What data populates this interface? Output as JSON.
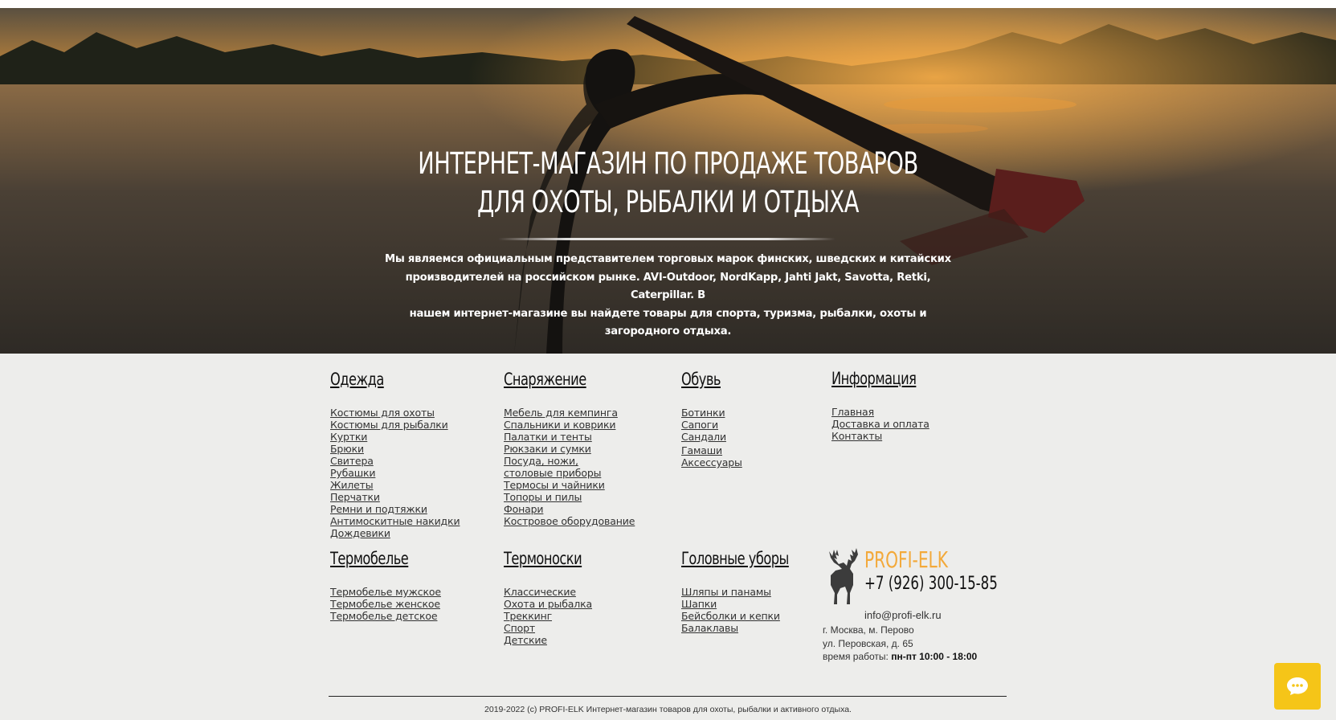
{
  "hero": {
    "title_line1": "ИНТЕРНЕТ-МАГАЗИН ПО ПРОДАЖЕ ТОВАРОВ",
    "title_line2": "ДЛЯ ОХОТЫ, РЫБАЛКИ И ОТДЫХА",
    "text_line1": "Мы являемся официальным представителем торговых марок финских, шведских и китайских",
    "text_line2": "производителей на российском рынке.  AVI-Outdoor, NordKapp, Jahti Jakt, Savotta, Retki, Caterpillar. В",
    "text_line3": "нашем интернет-магазине вы найдете товары для спорта, туризма, рыбалки, охоты и загородного отдыха."
  },
  "menu": {
    "clothing": {
      "title": "Одежда",
      "items": [
        "Костюмы для охоты",
        "Костюмы для рыбалки",
        "Куртки",
        "Брюки",
        "Свитера",
        "Рубашки",
        "Жилеты",
        "Перчатки",
        "Ремни и подтяжки",
        "Антимоскитные накидки",
        "Дождевики"
      ]
    },
    "gear": {
      "title": "Снаряжение",
      "items": [
        "Мебель для кемпинга",
        "Спальники и коврики",
        "Палатки и тенты",
        "Рюкзаки и сумки",
        "Посуда, ножи,",
        "столовые приборы",
        "Термосы и чайники",
        "Топоры и пилы",
        "Фонари",
        "Костровое оборудование"
      ]
    },
    "footwear": {
      "title": "Обувь",
      "items": [
        "Ботинки",
        "Сапоги",
        "Сандали",
        "Гамаши",
        "Аксессуары"
      ]
    },
    "info": {
      "title": "Информация",
      "items": [
        "Главная",
        "Доставка и оплата",
        "Контакты"
      ]
    },
    "thermal": {
      "title": "Термобелье",
      "items": [
        "Термобелье мужское",
        "Термобелье женское",
        "Термобелье детское"
      ]
    },
    "socks": {
      "title": "Термоноски",
      "items": [
        "Классические",
        "Охота и рыбалка",
        "Треккинг",
        "Спорт",
        "Детские"
      ]
    },
    "hats": {
      "title": "Головные уборы",
      "items": [
        "Шляпы и панамы",
        "Шапки",
        "Бейсболки и кепки",
        "Балаклавы"
      ]
    }
  },
  "contacts": {
    "brand": "PROFI-ELK",
    "phone": "+7 (926) 300-15-85",
    "email": "info@profi-elk.ru",
    "address_line1": "г. Москва, м. Перово",
    "address_line2": "ул. Перовская, д. 65",
    "hours_label": "время работы: ",
    "hours_value": "пн-пт 10:00 - 18:00"
  },
  "footer": {
    "copyright": "2019-2022 (с) PROFI-ELK Интернет-магазин товаров для охоты, рыбалки и активного отдыха."
  },
  "colors": {
    "brand_orange": "#f3a93a",
    "chat_yellow": "#f5c518",
    "page_bg": "#ededeb"
  },
  "icons": {
    "logo": "elk-logo-icon",
    "chat": "chat-icon"
  }
}
